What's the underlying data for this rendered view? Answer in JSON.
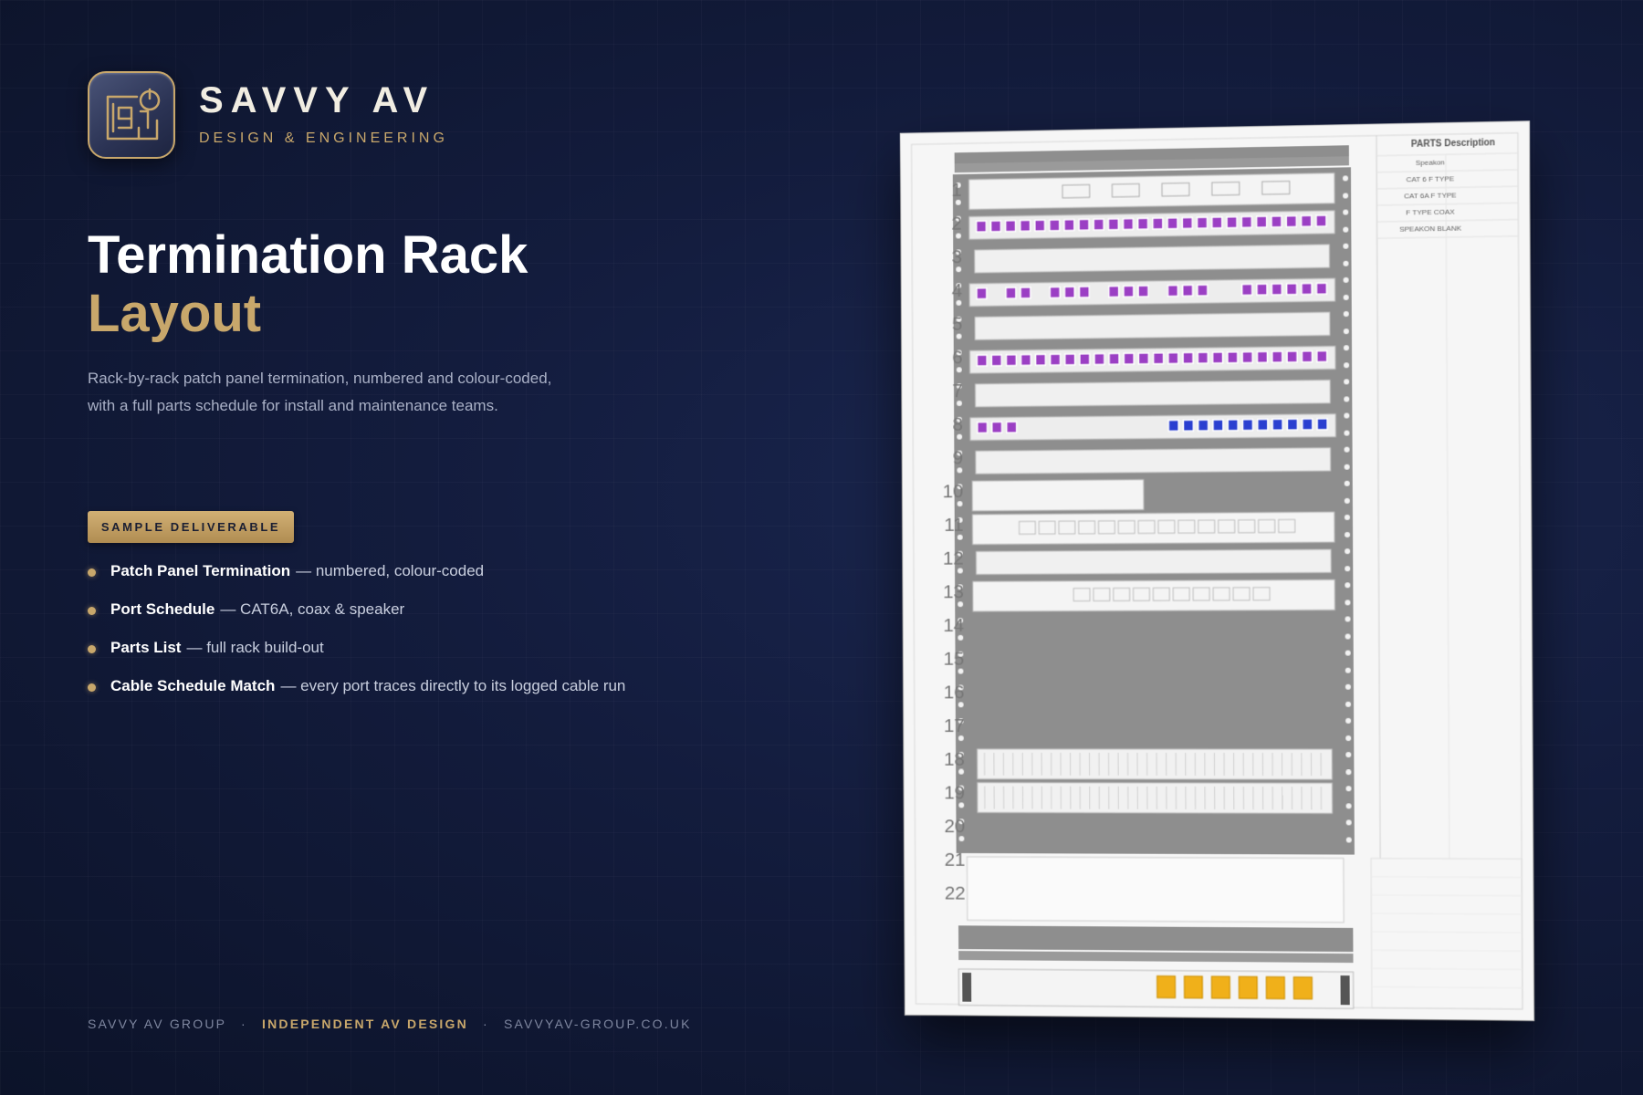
{
  "brand": {
    "name": "SAVVY AV",
    "tagline": "DESIGN & ENGINEERING",
    "logo_icon": "floorplan-power-icon"
  },
  "hero": {
    "title_line1": "Termination Rack",
    "title_line2": "Layout",
    "description": "Rack-by-rack patch panel termination, numbered and colour-coded, with a full parts schedule for install and maintenance teams."
  },
  "badge": "SAMPLE DELIVERABLE",
  "features": [
    {
      "name": "Patch Panel Termination",
      "detail": "— numbered, colour-coded"
    },
    {
      "name": "Port Schedule",
      "detail": "— CAT6A, coax & speaker"
    },
    {
      "name": "Parts List",
      "detail": "— full rack build-out"
    },
    {
      "name": "Cable Schedule Match",
      "detail": "— every port traces directly to its logged cable run"
    }
  ],
  "footer": {
    "company": "SAVVY AV GROUP",
    "highlight": "INDEPENDENT AV DESIGN",
    "website": "SAVVYAV-GROUP.CO.UK",
    "separator": "·"
  },
  "drawing": {
    "rack_units": [
      "1",
      "2",
      "3",
      "4",
      "5",
      "6",
      "7",
      "8",
      "9",
      "10",
      "11",
      "12",
      "13",
      "14",
      "15",
      "16",
      "17",
      "18",
      "19",
      "20",
      "21",
      "22"
    ],
    "parts_title": "PARTS Description",
    "parts": [
      "Speakon",
      "CAT 6 F TYPE",
      "CAT 6A F TYPE",
      "F TYPE COAX",
      "SPEAKON BLANK"
    ],
    "colors": {
      "cat6_port": "#9b3fc4",
      "cat6a_port": "#2a3fd0",
      "power_outlet": "#f0b01a",
      "rack_gray": "#8e8e8e"
    }
  },
  "colors": {
    "background": "#131c3d",
    "accent_gold": "#c8a76b",
    "text_primary": "#ffffff",
    "text_muted": "#a9b0c6"
  }
}
